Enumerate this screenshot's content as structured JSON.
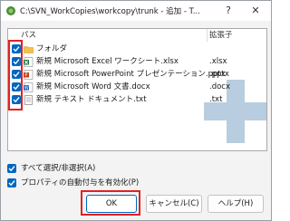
{
  "window": {
    "title": "C:\\SVN_WorkCopies\\workcopy\\trunk - 追加 - T...",
    "help_glyph": "?",
    "close_glyph": "✕"
  },
  "list": {
    "columns": {
      "path": "パス",
      "ext": "拡張子"
    },
    "items": [
      {
        "name": "フォルダ",
        "ext": "",
        "icon": "folder-icon",
        "checked": true
      },
      {
        "name": "新規 Microsoft Excel ワークシート.xlsx",
        "ext": ".xlsx",
        "icon": "excel-file-icon",
        "checked": true
      },
      {
        "name": "新規 Microsoft PowerPoint プレゼンテーション.pptx",
        "ext": ".pptx",
        "icon": "powerpoint-file-icon",
        "checked": true
      },
      {
        "name": "新規 Microsoft Word 文書.docx",
        "ext": ".docx",
        "icon": "word-file-icon",
        "checked": true
      },
      {
        "name": "新規 テキスト ドキュメント.txt",
        "ext": ".txt",
        "icon": "text-file-icon",
        "checked": true
      }
    ]
  },
  "options": {
    "select_all": {
      "label": "すべて選択/非選択(A)",
      "checked": true
    },
    "auto_props": {
      "label": "プロパティの自動付与を有効化(P)",
      "checked": true
    }
  },
  "buttons": {
    "ok": "OK",
    "cancel": "キャンセル(C)",
    "help": "ヘルプ(H)"
  },
  "colors": {
    "accent": "#0067c0",
    "highlight_box": "#e52020",
    "watermark": "#7fa6c6"
  }
}
